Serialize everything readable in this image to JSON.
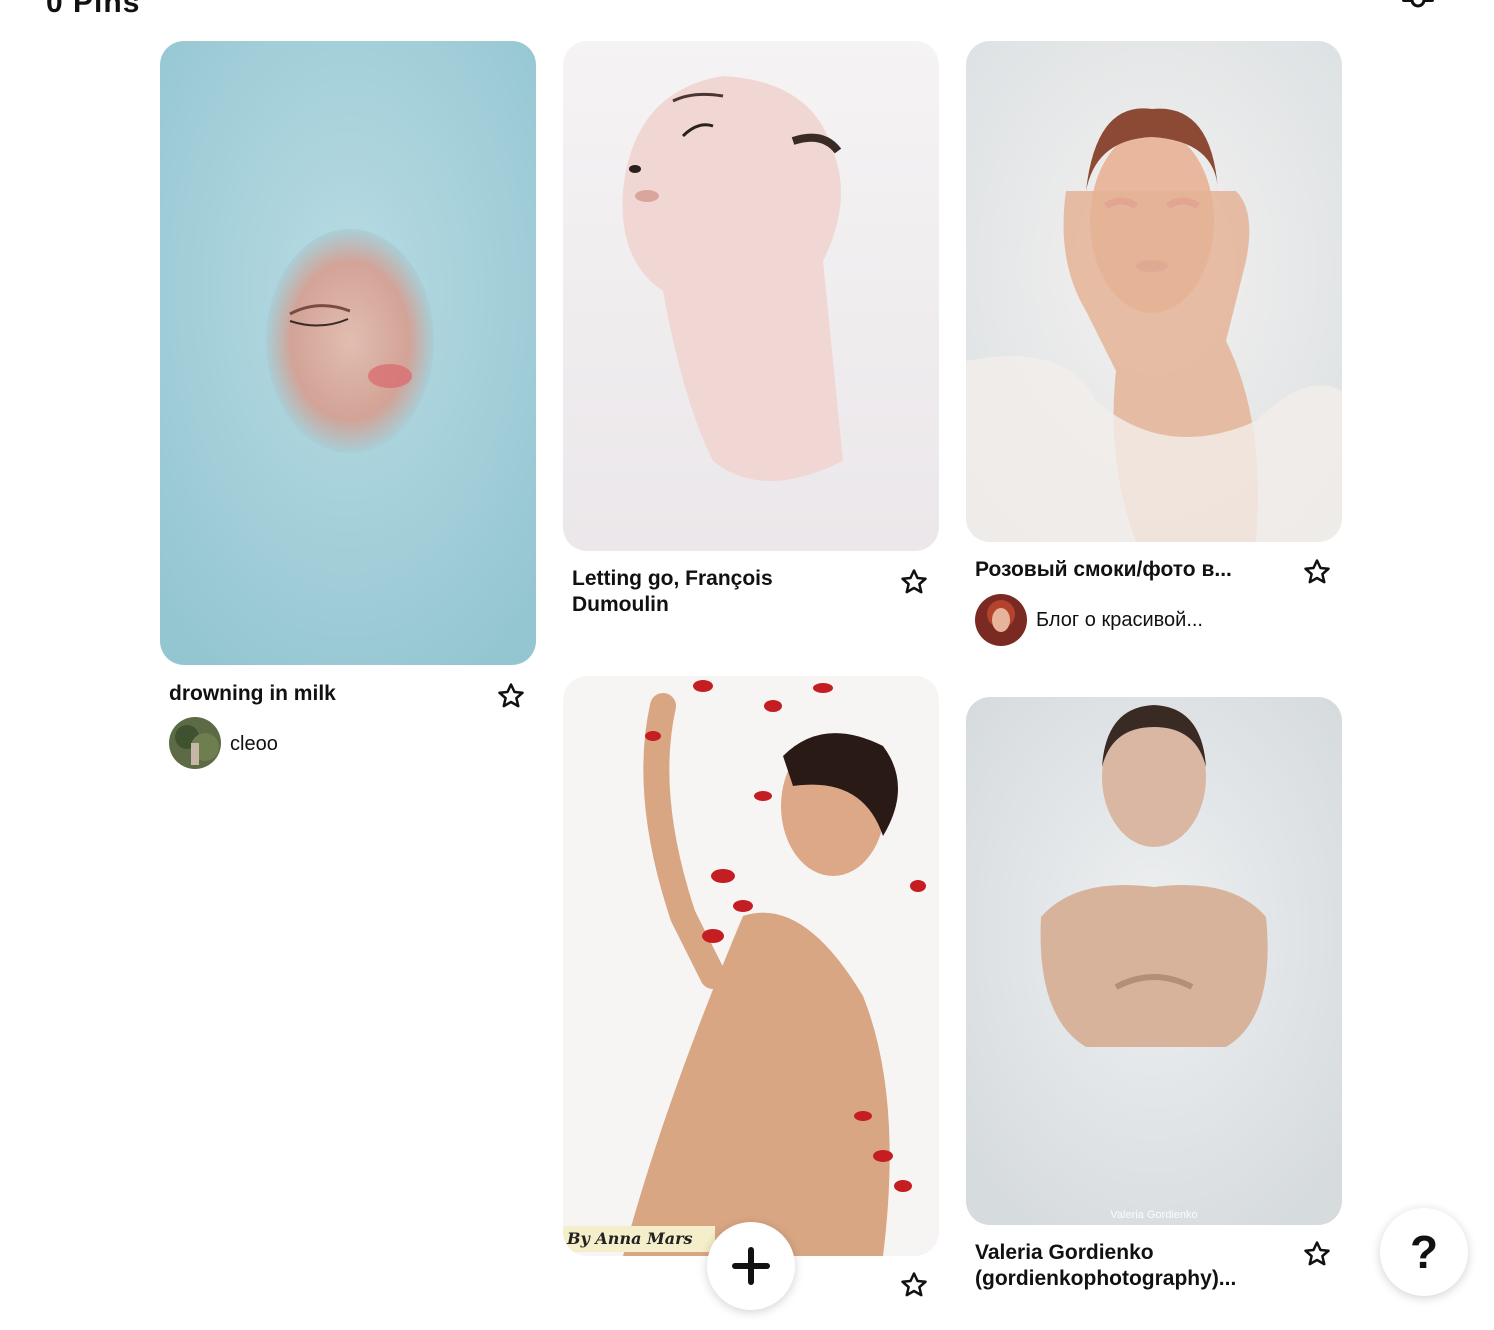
{
  "header": {
    "pin_count": "0 Pins"
  },
  "pins": [
    {
      "title": "drowning in milk",
      "author": "cleoo",
      "image_desc": "face in milky blue water"
    },
    {
      "title": "Letting go, François Dumoulin",
      "image_desc": "face floating in white milk"
    },
    {
      "title": "Розовый смоки/фото в...",
      "author": "Блог о красивой...",
      "image_desc": "woman in milk bath with pink makeup"
    },
    {
      "title": "",
      "watermark": "By Anna Mars",
      "image_desc": "woman in milk bath with red petals"
    },
    {
      "title": "Valeria Gordienko (gordienkophotography)...",
      "watermark": "Valeria Gordienko",
      "image_desc": "woman in milk bathtub"
    }
  ],
  "actions": {
    "add_label": "+",
    "help_label": "?"
  },
  "colors": {
    "accent": "#111111",
    "background": "#ffffff"
  }
}
